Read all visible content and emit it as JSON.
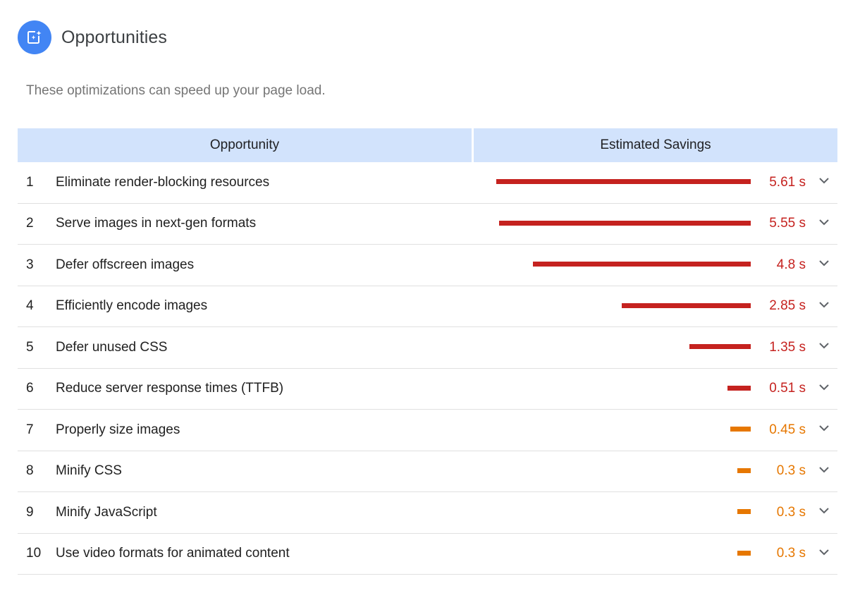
{
  "header": {
    "title": "Opportunities",
    "subtitle": "These optimizations can speed up your page load."
  },
  "table": {
    "columns": [
      "Opportunity",
      "Estimated Savings"
    ],
    "rows": [
      {
        "index": "1",
        "title": "Eliminate render-blocking resources",
        "savings": "5.61 s",
        "seconds": 5.61,
        "severity": "fail"
      },
      {
        "index": "2",
        "title": "Serve images in next-gen formats",
        "savings": "5.55 s",
        "seconds": 5.55,
        "severity": "fail"
      },
      {
        "index": "3",
        "title": "Defer offscreen images",
        "savings": "4.8 s",
        "seconds": 4.8,
        "severity": "fail"
      },
      {
        "index": "4",
        "title": "Efficiently encode images",
        "savings": "2.85 s",
        "seconds": 2.85,
        "severity": "fail"
      },
      {
        "index": "5",
        "title": "Defer unused CSS",
        "savings": "1.35 s",
        "seconds": 1.35,
        "severity": "fail"
      },
      {
        "index": "6",
        "title": "Reduce server response times (TTFB)",
        "savings": "0.51 s",
        "seconds": 0.51,
        "severity": "fail"
      },
      {
        "index": "7",
        "title": "Properly size images",
        "savings": "0.45 s",
        "seconds": 0.45,
        "severity": "average"
      },
      {
        "index": "8",
        "title": "Minify CSS",
        "savings": "0.3 s",
        "seconds": 0.3,
        "severity": "average"
      },
      {
        "index": "9",
        "title": "Minify JavaScript",
        "savings": "0.3 s",
        "seconds": 0.3,
        "severity": "average"
      },
      {
        "index": "10",
        "title": "Use video formats for animated content",
        "savings": "0.3 s",
        "seconds": 0.3,
        "severity": "average"
      }
    ]
  },
  "colors": {
    "fail": "#c5221f",
    "average": "#e67700",
    "header_bg": "#d2e3fc",
    "accent": "#4285f4"
  },
  "icons": {
    "header": "opportunity-icon",
    "expand": "chevron-down-icon"
  }
}
